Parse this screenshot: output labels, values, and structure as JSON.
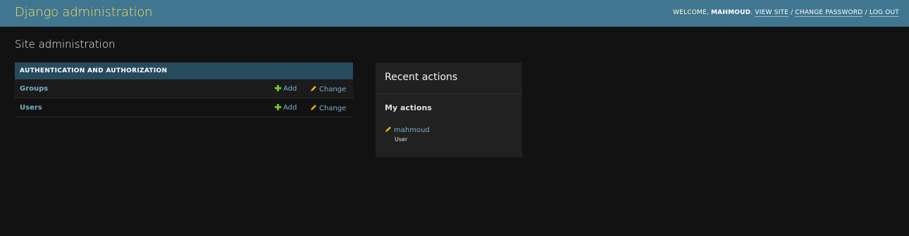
{
  "header": {
    "site_name": "Django administration",
    "welcome_text": "Welcome,",
    "username": "mahmoud",
    "view_site": "View site",
    "change_password": "Change password",
    "log_out": "Log out",
    "separator": "/"
  },
  "page_title": "Site administration",
  "app_module": {
    "caption": "Authentication and Authorization",
    "models": [
      {
        "name": "Groups",
        "add_label": "Add",
        "change_label": "Change"
      },
      {
        "name": "Users",
        "add_label": "Add",
        "change_label": "Change"
      }
    ]
  },
  "recent_actions": {
    "title": "Recent actions",
    "my_actions_heading": "My actions",
    "items": [
      {
        "object": "mahmoud",
        "content_type": "User",
        "icon": "pencil-icon"
      }
    ]
  },
  "colors": {
    "header_bg": "#417690",
    "branding": "#f5dd5d",
    "module_caption_bg": "#264b5d",
    "link": "#79aec8",
    "add_icon": "#70bf2b",
    "change_icon": "#efb80b",
    "page_bg": "#121212"
  }
}
